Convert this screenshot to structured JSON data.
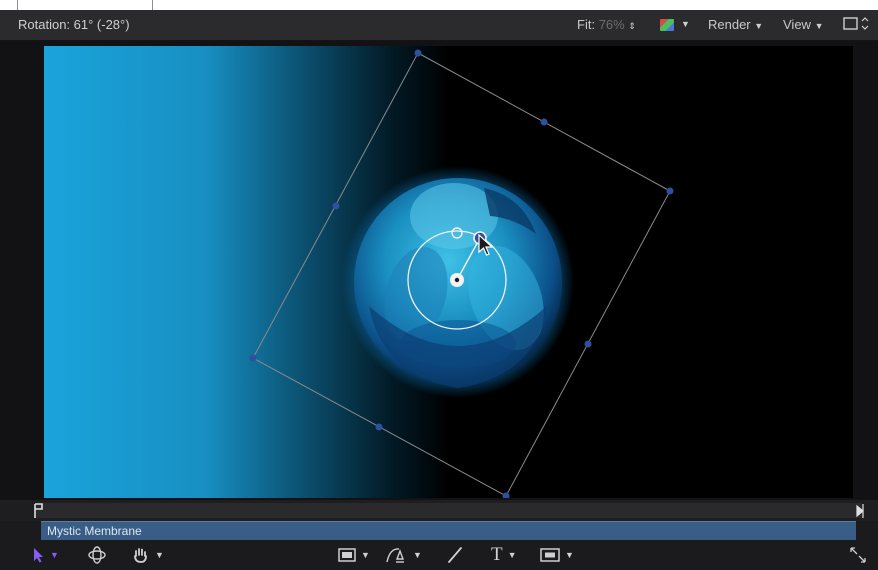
{
  "header": {
    "rotation_label": "Rotation: 61° (-28°)",
    "fit_label": "Fit:",
    "fit_value": "76%",
    "render_label": "Render",
    "view_label": "View"
  },
  "timeline": {
    "clip_name": "Mystic Membrane"
  },
  "colors": {
    "canvas_gradient_start": "#1aa4dc",
    "clip_bar": "#3a5d86",
    "handle": "#2f4fa0",
    "select_tool": "#8a5cf6"
  },
  "icons": [
    "selection-arrow-icon",
    "orbit-3d-icon",
    "hand-pan-icon",
    "rectangle-shape-icon",
    "bezier-pen-icon",
    "paint-stroke-icon",
    "text-tool-icon",
    "mask-icon",
    "channels-swatch-icon",
    "layer-toggle-icon",
    "fullscreen-icon"
  ]
}
